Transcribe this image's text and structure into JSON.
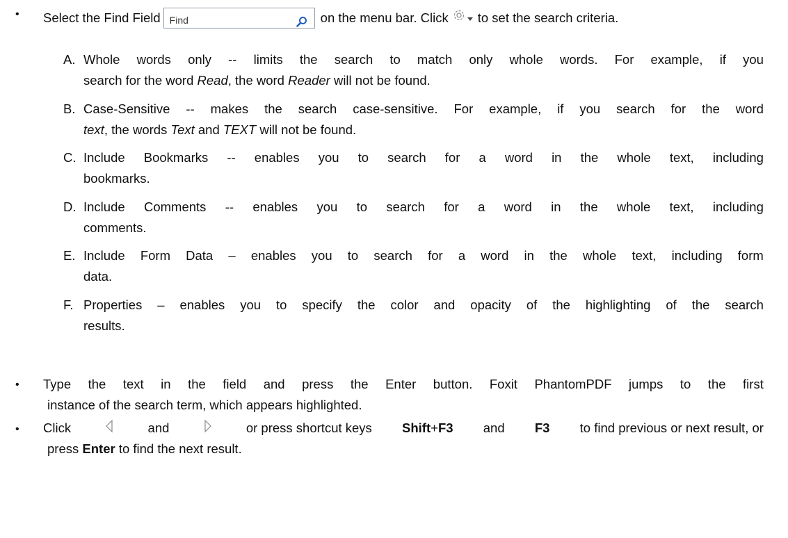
{
  "intro": {
    "bullet": "•",
    "before": "Select the Find Field",
    "find_placeholder": "Find",
    "middle": "on the menu bar. Click",
    "after": "to set the search criteria."
  },
  "options": [
    {
      "marker": "A.",
      "l1": [
        "Whole",
        "words",
        "only",
        "--",
        "limits",
        "the",
        "search",
        "to",
        "match",
        "only",
        "whole",
        "words.",
        "For",
        "example,",
        "if",
        "you"
      ],
      "l2a": "search for the word ",
      "l2i1": "Read",
      "l2b": ", the word ",
      "l2i2": "Reader",
      "l2c": " will not be found."
    },
    {
      "marker": "B.",
      "l1": [
        "Case-Sensitive",
        "--",
        "makes",
        "the",
        "search",
        "case-sensitive.",
        "For",
        "example,",
        "if",
        "you",
        "search",
        "for",
        "the",
        "word"
      ],
      "l2i0": "text",
      "l2a": ", the words ",
      "l2i1": "Text",
      "l2b": " and ",
      "l2i2": "TEXT",
      "l2c": " will not be found."
    },
    {
      "marker": "C.",
      "l1": [
        "Include",
        "Bookmarks",
        "--",
        "enables",
        "you",
        "to",
        "search",
        "for",
        "a",
        "word",
        "in",
        "the",
        "whole",
        "text,",
        "including"
      ],
      "l2": "bookmarks."
    },
    {
      "marker": "D.",
      "l1": [
        "Include",
        "Comments",
        "--",
        "enables",
        "you",
        "to",
        "search",
        "for",
        "a",
        "word",
        "in",
        "the",
        "whole",
        "text,",
        "including"
      ],
      "l2": "comments."
    },
    {
      "marker": "E.",
      "l1": [
        "Include",
        "Form",
        "Data",
        "–",
        "enables",
        "you",
        "to",
        "search",
        "for",
        "a",
        "word",
        "in",
        "the",
        "whole",
        "text,",
        "including",
        "form"
      ],
      "l2": "data."
    },
    {
      "marker": "F.",
      "l1": [
        "Properties",
        "–",
        "enables",
        "you",
        "to",
        "specify",
        "the",
        "color",
        "and",
        "opacity",
        "of",
        "the",
        "highlighting",
        "of",
        "the",
        "search"
      ],
      "l2": "results."
    }
  ],
  "type_step": {
    "bullet": "•",
    "l1": [
      "Type",
      "the",
      "text",
      "in",
      "the",
      "field",
      "and",
      "press",
      "the",
      "Enter",
      "button.",
      "Foxit",
      "PhantomPDF",
      "jumps",
      "to",
      "the",
      "first"
    ],
    "l2": "instance of the search term, which appears highlighted."
  },
  "nav_step": {
    "bullet": "•",
    "click": "Click",
    "and": "and",
    "or_press": "or press shortcut keys",
    "shift": "Shift",
    "plus": "+",
    "f3a": "F3",
    "and2": "and",
    "f3b": "F3",
    "rest1": "to find previous or next result, or",
    "press": "press ",
    "enter": "Enter",
    "rest2": " to find the next result."
  },
  "icons": {
    "search": "magnifier-icon",
    "settings": "gear-icon",
    "dropdown": "dropdown-arrow-icon",
    "prev": "previous-arrow-icon",
    "next": "next-arrow-icon"
  },
  "colors": {
    "find_border": "#8f9aa8",
    "magnifier": "#1f5fbf",
    "icon_gray": "#8a8a8a"
  }
}
